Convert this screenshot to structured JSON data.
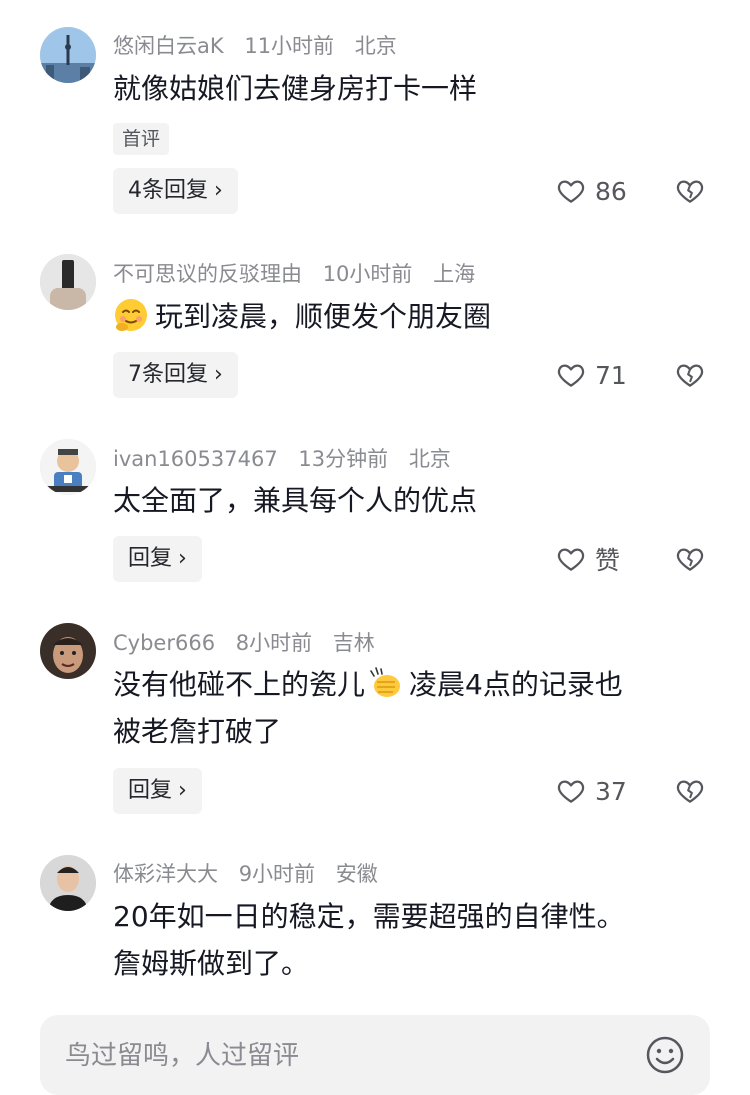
{
  "comments": [
    {
      "username": "悠闲白云aK",
      "time": "11小时前",
      "location": "北京",
      "text": "就像姑娘们去健身房打卡一样",
      "tag": "首评",
      "reply": "4条回复",
      "likes": "86",
      "avatar_icon": "tower-avatar"
    },
    {
      "username": "不可思议的反驳理由",
      "time": "10小时前",
      "location": "上海",
      "emoji": "shy-face-emoji",
      "text": "玩到凌晨，顺便发个朋友圈",
      "reply": "7条回复",
      "likes": "71",
      "avatar_icon": "phone-avatar"
    },
    {
      "username": "ivan160537467",
      "time": "13分钟前",
      "location": "北京",
      "text": "太全面了，兼具每个人的优点",
      "reply": "回复",
      "likes": "赞",
      "avatar_icon": "cartoon-avatar"
    },
    {
      "username": "Cyber666",
      "time": "8小时前",
      "location": "吉林",
      "text_before": "没有他碰不上的瓷儿",
      "emoji": "fist-bump-emoji",
      "text_after": "凌晨4点的记录也",
      "text_line2": "被老詹打破了",
      "reply": "回复",
      "likes": "37",
      "avatar_icon": "face-avatar"
    },
    {
      "username": "体彩洋大大",
      "time": "9小时前",
      "location": "安徽",
      "text_line1": "20年如一日的稳定，需要超强的自律性。",
      "text_line2": "詹姆斯做到了。",
      "avatar_icon": "person-avatar"
    }
  ],
  "input": {
    "placeholder": "鸟过留鸣，人过留评",
    "emoji_icon": "smiley-icon"
  },
  "icons": {
    "like": "heart-outline-icon",
    "dislike": "broken-heart-icon",
    "chevron": "chevron-right-icon"
  }
}
